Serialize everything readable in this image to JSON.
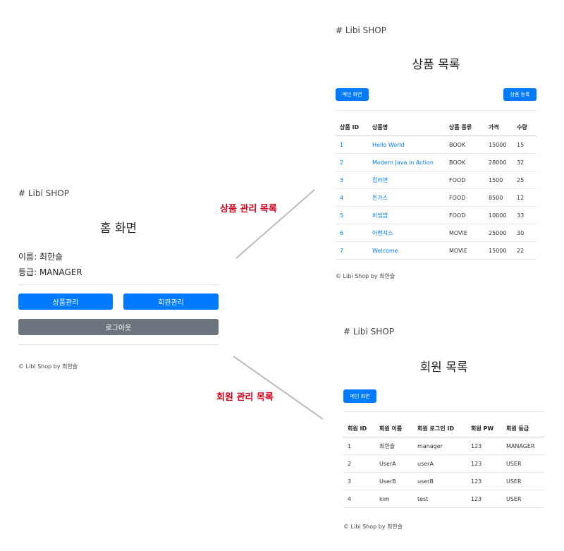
{
  "home": {
    "brand": "# Libi SHOP",
    "title": "홈 화면",
    "name_line": "이름: 최한슬",
    "grade_line": "등급: MANAGER",
    "product_btn": "상품관리",
    "member_btn": "회원관리",
    "logout_btn": "로그아웃",
    "footer": "© Libi Shop by 최한슬"
  },
  "callouts": {
    "products": "상품 관리 목록",
    "members": "회원 관리 목록"
  },
  "products": {
    "brand": "# Libi SHOP",
    "title": "상품 목록",
    "main_btn": "메인 화면",
    "register_btn": "상품 등록",
    "columns": [
      "상품 ID",
      "상품명",
      "상품 종류",
      "가격",
      "수량"
    ],
    "rows": [
      [
        "1",
        "Hello World",
        "BOOK",
        "15000",
        "15"
      ],
      [
        "2",
        "Modern Java in Action",
        "BOOK",
        "28000",
        "32"
      ],
      [
        "3",
        "컵라면",
        "FOOD",
        "1500",
        "25"
      ],
      [
        "4",
        "돈가스",
        "FOOD",
        "8500",
        "12"
      ],
      [
        "5",
        "비빔밥",
        "FOOD",
        "10000",
        "33"
      ],
      [
        "6",
        "어벤져스",
        "MOVIE",
        "25000",
        "30"
      ],
      [
        "7",
        "Welcome",
        "MOVIE",
        "15000",
        "22"
      ]
    ],
    "footer": "© Libi Shop by 최한슬"
  },
  "members": {
    "brand": "# Libi SHOP",
    "title": "회원 목록",
    "main_btn": "메인 화면",
    "columns": [
      "회원 ID",
      "회원 이름",
      "회원 로그인 ID",
      "회원 PW",
      "회원 등급"
    ],
    "rows": [
      [
        "1",
        "최한슬",
        "manager",
        "123",
        "MANAGER"
      ],
      [
        "2",
        "UserA",
        "userA",
        "123",
        "USER"
      ],
      [
        "3",
        "UserB",
        "userB",
        "123",
        "USER"
      ],
      [
        "4",
        "kim",
        "test",
        "123",
        "USER"
      ]
    ],
    "footer": "© Libi Shop by 최한슬"
  },
  "colors": {
    "primary": "#007bff",
    "secondary": "#6c757d",
    "callout": "#d4001a",
    "connector": "#bbbbbb"
  }
}
